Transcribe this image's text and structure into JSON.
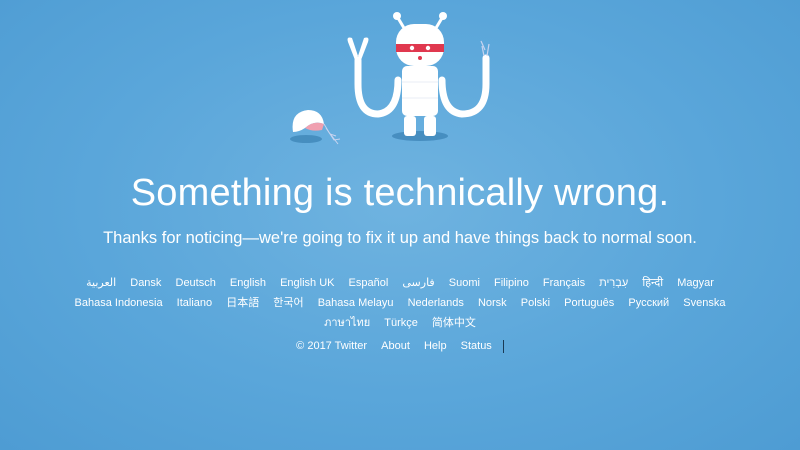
{
  "heading": "Something is technically wrong.",
  "subheading": "Thanks for noticing—we're going to fix it up and have things back to normal soon.",
  "languages": {
    "row1": [
      "العربية",
      "Dansk",
      "Deutsch",
      "English",
      "English UK",
      "Español",
      "فارسی",
      "Suomi",
      "Filipino",
      "Français",
      "עִבְרִית",
      "हिन्दी",
      "Magyar"
    ],
    "row2": [
      "Bahasa Indonesia",
      "Italiano",
      "日本語",
      "한국어",
      "Bahasa Melayu",
      "Nederlands",
      "Norsk",
      "Polski",
      "Português",
      "Русский",
      "Svenska"
    ],
    "row3": [
      "ภาษาไทย",
      "Türkçe",
      "简体中文"
    ]
  },
  "footer": {
    "copyright": "© 2017 Twitter",
    "about": "About",
    "help": "Help",
    "status": "Status"
  },
  "colors": {
    "background": "#5aa6da",
    "robot_body": "#ffffff",
    "robot_eyes": "#e0384f"
  }
}
